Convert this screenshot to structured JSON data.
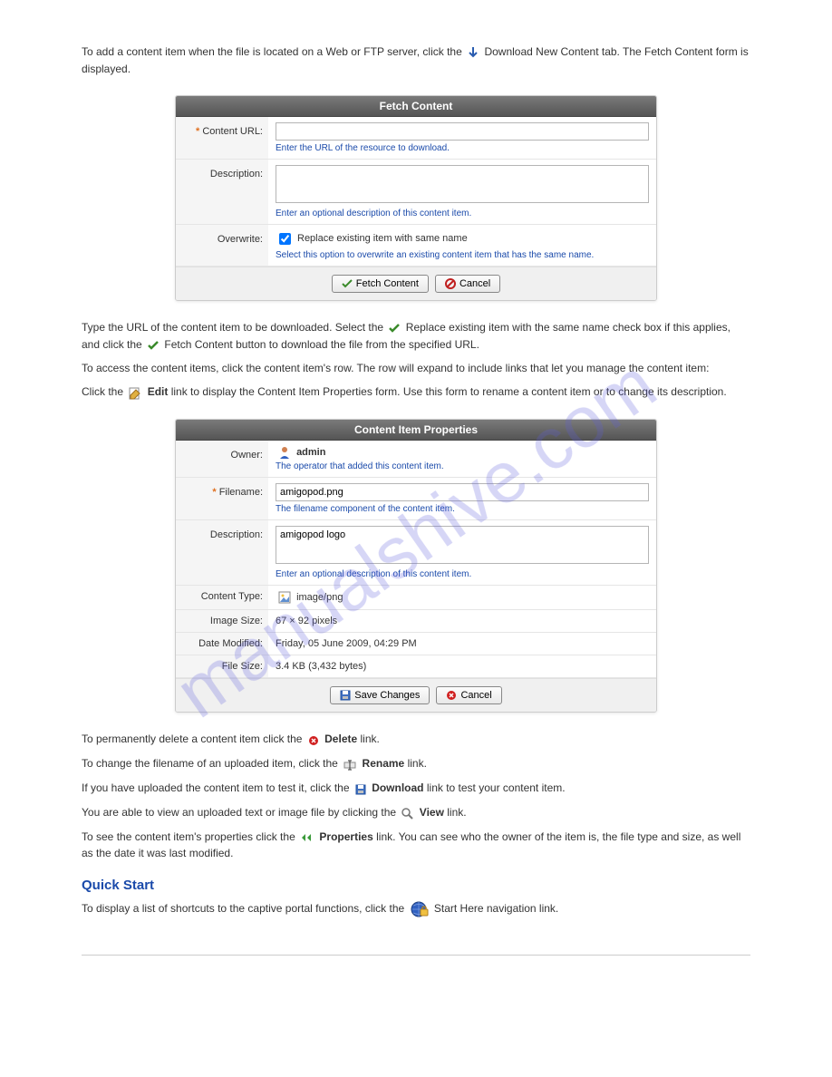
{
  "t1": "To add a content item when the file is located on a Web or FTP server, click the ",
  "t1b": " Download New Content tab. The Fetch Content form is displayed.",
  "panel1": {
    "title": "Fetch Content",
    "url_label": "Content URL:",
    "url_hint": "Enter the URL of the resource to download.",
    "desc_label": "Description:",
    "desc_hint": "Enter an optional description of this content item.",
    "ow_label": "Overwrite:",
    "ow_check": "Replace existing item with same name",
    "ow_hint": "Select this option to overwrite an existing content item that has the same name.",
    "btn_fetch": "Fetch Content",
    "btn_cancel": "Cancel"
  },
  "t2": "Type the URL of the content item to be downloaded. Select the ",
  "t2b": " Replace existing item with the same name check box if this applies, and click the ",
  "t2c": " Fetch Content button to download the file from the specified URL.",
  "t3": "To access the content items, click the content item's row. The row will expand to include links that let you manage the content item:",
  "t4a": "Click the ",
  "t4i": "Edit",
  "t4b": " link to display the Content Item Properties form. Use this form to rename a content item or to change its description.",
  "panel2": {
    "title": "Content Item Properties",
    "owner_label": "Owner:",
    "owner_val": "admin",
    "owner_hint": "The operator that added this content item.",
    "file_label": "Filename:",
    "file_val": "amigopod.png",
    "file_hint": "The filename component of the content item.",
    "desc_label": "Description:",
    "desc_val": "amigopod logo",
    "desc_hint": "Enter an optional description of this content item.",
    "ct_label": "Content Type:",
    "ct_val": "image/png",
    "is_label": "Image Size:",
    "is_val": "67 × 92 pixels",
    "dm_label": "Date Modified:",
    "dm_val": "Friday, 05 June 2009, 04:29 PM",
    "fs_label": "File Size:",
    "fs_val": "3.4 KB (3,432 bytes)",
    "btn_save": "Save Changes",
    "btn_cancel": "Cancel"
  },
  "t5": "To permanently delete a content item click the ",
  "t5d": "Delete",
  "t5b": " link.",
  "t6a": "To change the filename of an uploaded item, click the ",
  "t6r": "Rename",
  "t6b": " link.",
  "t7a": "If you have uploaded the content item to test it, click the ",
  "t7d": "Download",
  "t7b": " link to test your content item.",
  "t8a": "You are able to view an uploaded text or image file by clicking the ",
  "t8v": "View",
  "t8b": " link.",
  "t9a": "To see the content item's properties click the ",
  "t9p": "Properties",
  "t9b": " link. You can see who the owner of the item is, the file type and size, as well as the date it was last modified.",
  "qs": "Quick Start",
  "tqa": "To display a list of shortcuts to the captive portal functions, click the ",
  "tqb": " Start Here navigation link."
}
